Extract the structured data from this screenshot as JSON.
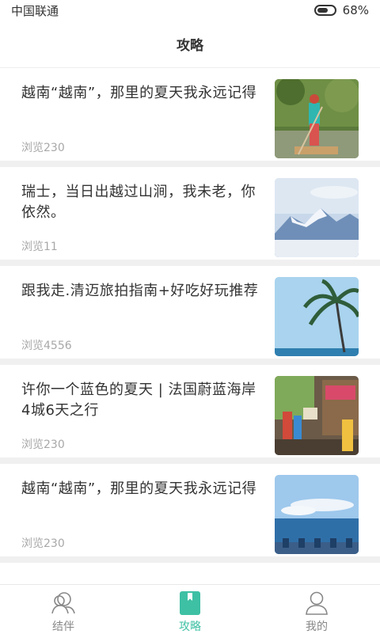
{
  "status": {
    "carrier": "中国联通",
    "battery": "68%",
    "battery_level": 0.68
  },
  "header": {
    "title": "攻略"
  },
  "articles": [
    {
      "title": "越南“越南”，那里的夏天我永远记得",
      "views": "浏览230",
      "image": "river-raft-photo"
    },
    {
      "title": "瑞士，当日出越过山涧，我未老，你依然。",
      "views": "浏览11",
      "image": "snow-mountain-photo"
    },
    {
      "title": "跟我走.清迈旅拍指南+好吃好玩推荐",
      "views": "浏览4556",
      "image": "palm-tree-photo"
    },
    {
      "title": "许你一个蓝色的夏天 | 法国蔚蓝海岸4城6天之行",
      "views": "浏览230",
      "image": "street-shops-photo"
    },
    {
      "title": "越南“越南”，那里的夏天我永远记得",
      "views": "浏览230",
      "image": "seaside-photo"
    }
  ],
  "tabbar": {
    "tabs": [
      {
        "label": "结伴",
        "icon": "companions-icon"
      },
      {
        "label": "攻略",
        "icon": "guide-bookmark-icon"
      },
      {
        "label": "我的",
        "icon": "profile-icon"
      }
    ],
    "active_color": "#3ec0a4",
    "inactive_color": "#888888"
  }
}
